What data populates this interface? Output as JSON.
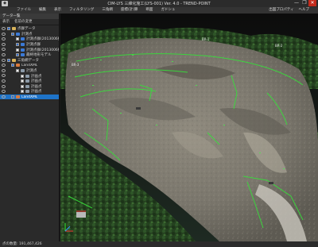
{
  "window": {
    "title": "CIM-LYS 三維化施工(LYS-001) Ver. 4.0 - TREND-POINT",
    "controls": [
      "—",
      "❐",
      "✕"
    ]
  },
  "menu": {
    "items": [
      "ファイル",
      "編集",
      "表示",
      "フィルタリング",
      "三角網",
      "座標(計)算",
      "断面",
      "ガドシュ"
    ],
    "right_items": [
      "出図プロパティ",
      "ヘルプ"
    ]
  },
  "panel": {
    "tab": "データ一覧",
    "header": [
      "表示",
      "名前の変更"
    ],
    "tree": [
      {
        "label": "点群データ",
        "level": 0,
        "checked": true,
        "icon": "folder",
        "selected": false
      },
      {
        "label": "計測点",
        "level": 1,
        "checked": true,
        "icon": "pc",
        "selected": false
      },
      {
        "label": "計測点群(2013006撮影)",
        "level": 2,
        "checked": false,
        "icon": "pc",
        "selected": false
      },
      {
        "label": "計測点群",
        "level": 2,
        "checked": true,
        "icon": "pc",
        "selected": false
      },
      {
        "label": "計測点群(2013006撮影)",
        "level": 2,
        "checked": false,
        "icon": "pc",
        "selected": false
      },
      {
        "label": "最終地形モデル",
        "level": 2,
        "checked": true,
        "icon": "pc",
        "selected": false
      },
      {
        "label": "三角網データ",
        "level": 0,
        "checked": true,
        "icon": "folder",
        "selected": false
      },
      {
        "label": "LandXML",
        "level": 1,
        "checked": true,
        "icon": "tin",
        "selected": false
      },
      {
        "label": "計測点",
        "level": 2,
        "checked": false,
        "icon": "layer",
        "selected": false
      },
      {
        "label": "計画点",
        "level": 3,
        "checked": false,
        "icon": "layer",
        "selected": false
      },
      {
        "label": "計画点",
        "level": 3,
        "checked": false,
        "icon": "layer",
        "selected": false
      },
      {
        "label": "計画点",
        "level": 3,
        "checked": false,
        "icon": "layer",
        "selected": false
      },
      {
        "label": "計画点",
        "level": 3,
        "checked": false,
        "icon": "layer",
        "selected": false
      },
      {
        "label": "LandXML",
        "level": 1,
        "checked": true,
        "icon": "tin",
        "selected": true
      }
    ]
  },
  "viewport": {
    "labels": [
      "BR-1",
      "BR-2",
      "BR-3"
    ]
  },
  "status": {
    "text": "点の数量: 191,467,426"
  }
}
